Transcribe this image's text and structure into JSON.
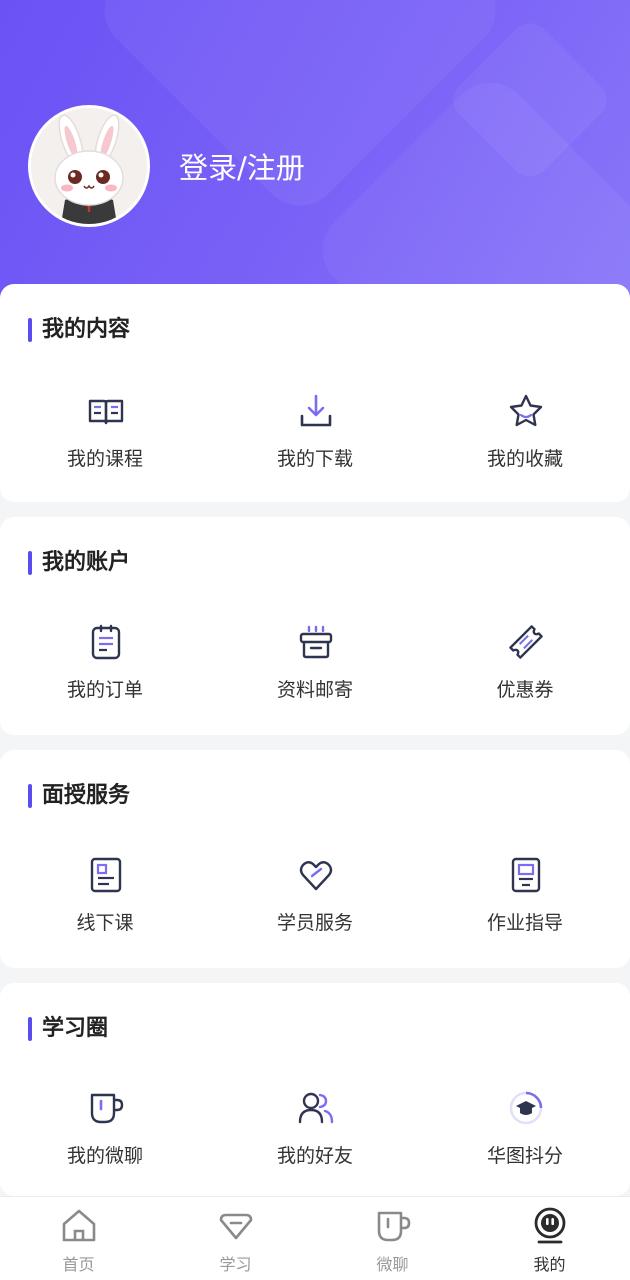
{
  "header": {
    "login_label": "登录/注册"
  },
  "sections": [
    {
      "title": "我的内容",
      "items": [
        {
          "label": "我的课程",
          "icon": "book-icon"
        },
        {
          "label": "我的下载",
          "icon": "download-icon"
        },
        {
          "label": "我的收藏",
          "icon": "star-icon"
        }
      ]
    },
    {
      "title": "我的账户",
      "items": [
        {
          "label": "我的订单",
          "icon": "clipboard-icon"
        },
        {
          "label": "资料邮寄",
          "icon": "package-icon"
        },
        {
          "label": "优惠券",
          "icon": "coupon-icon"
        }
      ]
    },
    {
      "title": "面授服务",
      "items": [
        {
          "label": "线下课",
          "icon": "document-icon"
        },
        {
          "label": "学员服务",
          "icon": "heart-icon"
        },
        {
          "label": "作业指导",
          "icon": "report-icon"
        }
      ]
    },
    {
      "title": "学习圈",
      "items": [
        {
          "label": "我的微聊",
          "icon": "cup-icon"
        },
        {
          "label": "我的好友",
          "icon": "friends-icon"
        },
        {
          "label": "华图抖分",
          "icon": "graduation-cap-icon"
        }
      ]
    }
  ],
  "tabbar": [
    {
      "label": "首页",
      "icon": "home-icon"
    },
    {
      "label": "学习",
      "icon": "diamond-icon"
    },
    {
      "label": "微聊",
      "icon": "cup-icon"
    },
    {
      "label": "我的",
      "icon": "profile-icon",
      "active": true
    }
  ],
  "colors": {
    "primary": "#6a52f5",
    "accent": "#5b4cf0",
    "icon_dark": "#2f3550",
    "tab_active": "#2b2b2b",
    "tab_inactive": "#8a8a8a"
  }
}
